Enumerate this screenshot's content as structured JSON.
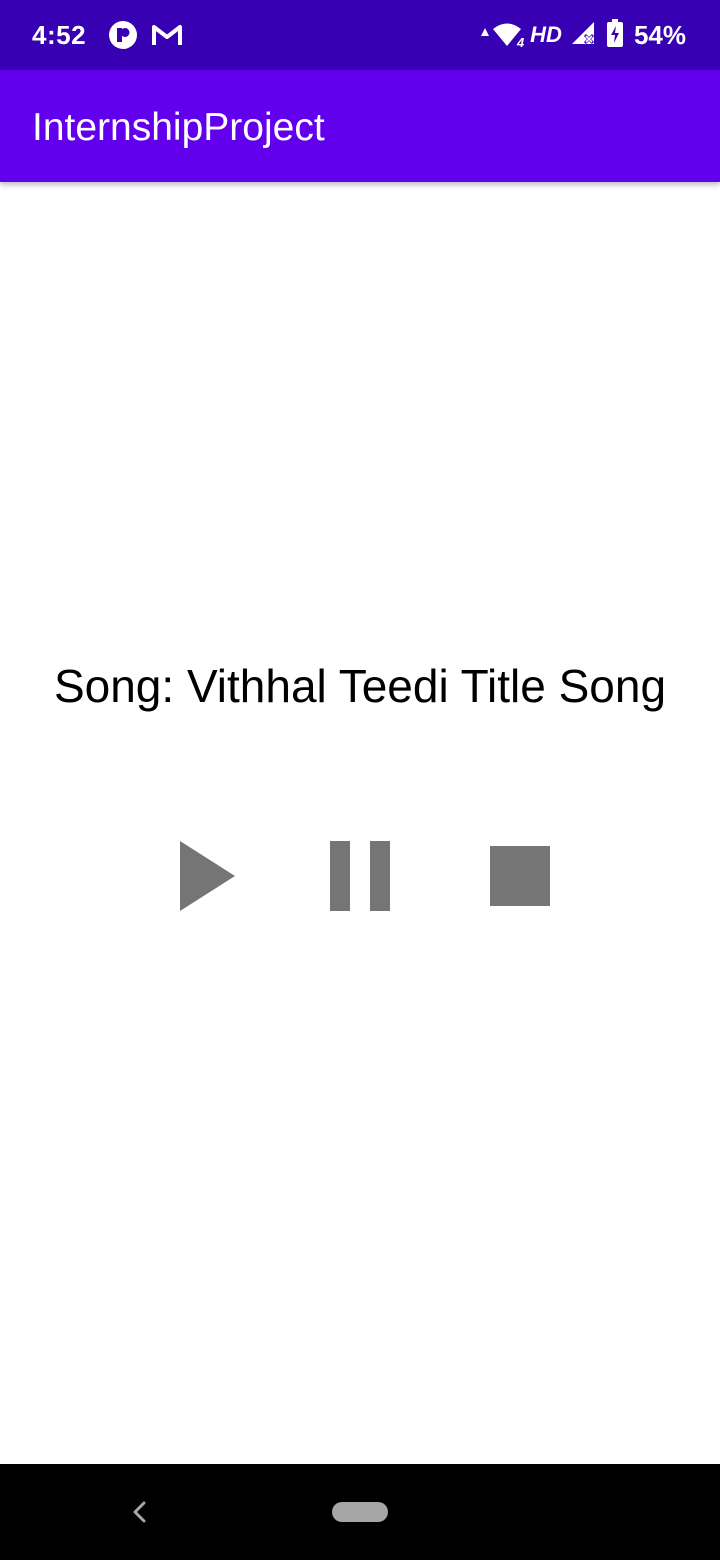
{
  "status_bar": {
    "time": "4:52",
    "left_icons": [
      "app-notification-icon",
      "gmail-icon"
    ],
    "right_icons": [
      "data-activity-icon",
      "wifi-icon",
      "signal-icon",
      "battery-charging-icon"
    ],
    "network_label": "HD",
    "wifi_badge": "4",
    "battery_percent": "54%",
    "background_color": "#3700b3"
  },
  "app_bar": {
    "title": "InternshipProject",
    "background_color": "#6200ee"
  },
  "main": {
    "song_label": "Song: Vithhal Teedi Title Song",
    "controls": [
      {
        "name": "play",
        "icon": "play-icon"
      },
      {
        "name": "pause",
        "icon": "pause-icon"
      },
      {
        "name": "stop",
        "icon": "stop-icon"
      }
    ],
    "control_color": "#757575"
  },
  "nav_bar": {
    "buttons": [
      "back-icon",
      "home-pill"
    ]
  }
}
